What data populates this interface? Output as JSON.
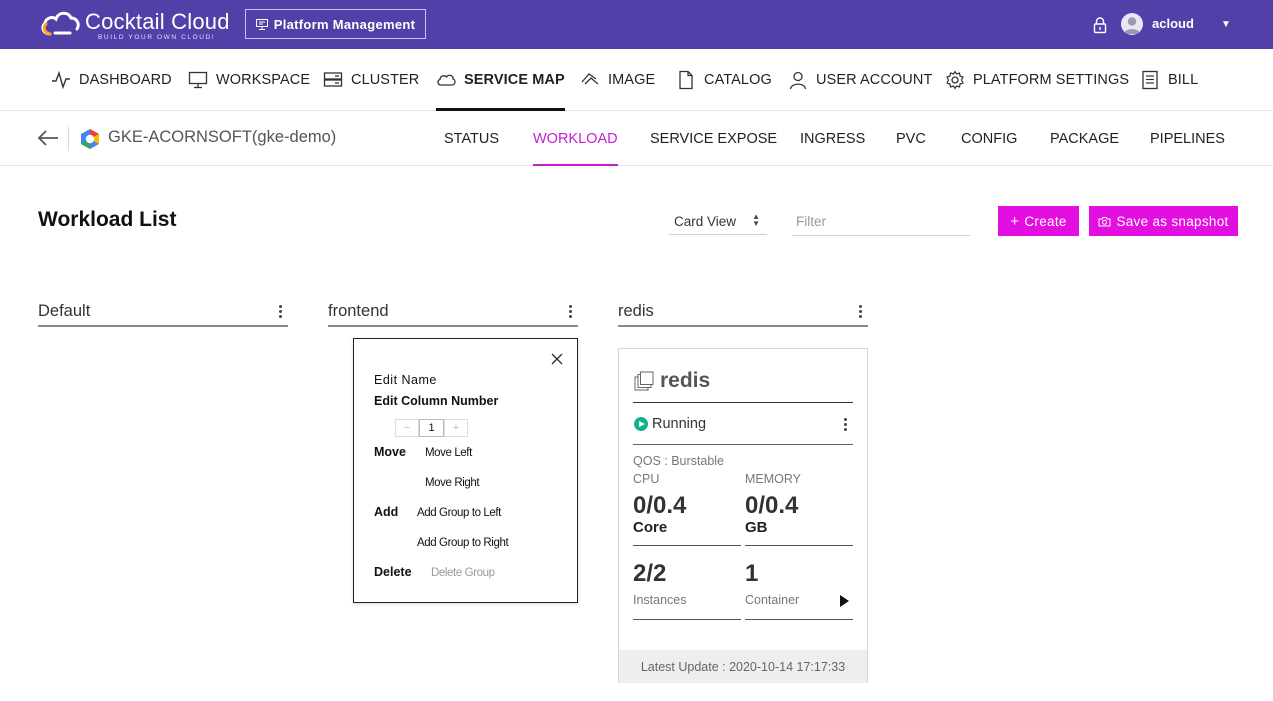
{
  "topbar": {
    "logo_title": "Cocktail Cloud",
    "logo_subtitle": "BUILD YOUR OWN CLOUD!",
    "platform_button": "Platform Management",
    "username": "acloud",
    "user_menu_caret": "▼",
    "colors": {
      "background": "#5140a8",
      "logo_accent": "#f6a623"
    }
  },
  "main_nav": [
    {
      "label": "DASHBOARD",
      "icon": "activity-icon"
    },
    {
      "label": "WORKSPACE",
      "icon": "monitor-icon"
    },
    {
      "label": "CLUSTER",
      "icon": "server-icon"
    },
    {
      "label": "SERVICE MAP",
      "icon": "cloud-icon",
      "active": true
    },
    {
      "label": "IMAGE",
      "icon": "image-icon"
    },
    {
      "label": "CATALOG",
      "icon": "document-icon"
    },
    {
      "label": "USER ACCOUNT",
      "icon": "user-icon"
    },
    {
      "label": "PLATFORM SETTINGS",
      "icon": "gear-icon"
    },
    {
      "label": "BILL",
      "icon": "bill-icon"
    }
  ],
  "sub_header": {
    "cluster_name": "GKE-ACORNSOFT(gke-demo)",
    "tabs": [
      {
        "label": "STATUS"
      },
      {
        "label": "WORKLOAD",
        "active": true
      },
      {
        "label": "SERVICE EXPOSE"
      },
      {
        "label": "INGRESS"
      },
      {
        "label": "PVC"
      },
      {
        "label": "CONFIG"
      },
      {
        "label": "PACKAGE"
      },
      {
        "label": "PIPELINES"
      }
    ],
    "active_color": "#c41fd0"
  },
  "toolbar": {
    "page_title": "Workload List",
    "view_select": "Card View",
    "filter_placeholder": "Filter",
    "create_label": "Create",
    "create_icon": "+",
    "snapshot_label": "Save as snapshot",
    "button_color": "#e20fe0"
  },
  "groups": [
    {
      "name": "Default"
    },
    {
      "name": "frontend"
    },
    {
      "name": "redis"
    }
  ],
  "group_menu": {
    "edit_name": "Edit Name",
    "edit_column_number": "Edit Column Number",
    "stepper": {
      "minus": "−",
      "value": "1",
      "plus": "+"
    },
    "move_label": "Move",
    "move_left": "Move Left",
    "move_right": "Move Right",
    "add_label": "Add",
    "add_group_left": "Add Group to Left",
    "add_group_right": "Add Group to Right",
    "delete_label": "Delete",
    "delete_group": "Delete Group"
  },
  "workload_card": {
    "name": "redis",
    "status": "Running",
    "qos": "QOS : Burstable",
    "cpu_label": "CPU",
    "cpu_value": "0/0.4",
    "cpu_unit": "Core",
    "memory_label": "MEMORY",
    "memory_value": "0/0.4",
    "memory_unit": "GB",
    "instances_value": "2/2",
    "instances_label": "Instances",
    "container_value": "1",
    "container_label": "Container",
    "latest_update": "Latest Update : 2020-10-14 17:17:33",
    "status_color": "#13b28a"
  }
}
